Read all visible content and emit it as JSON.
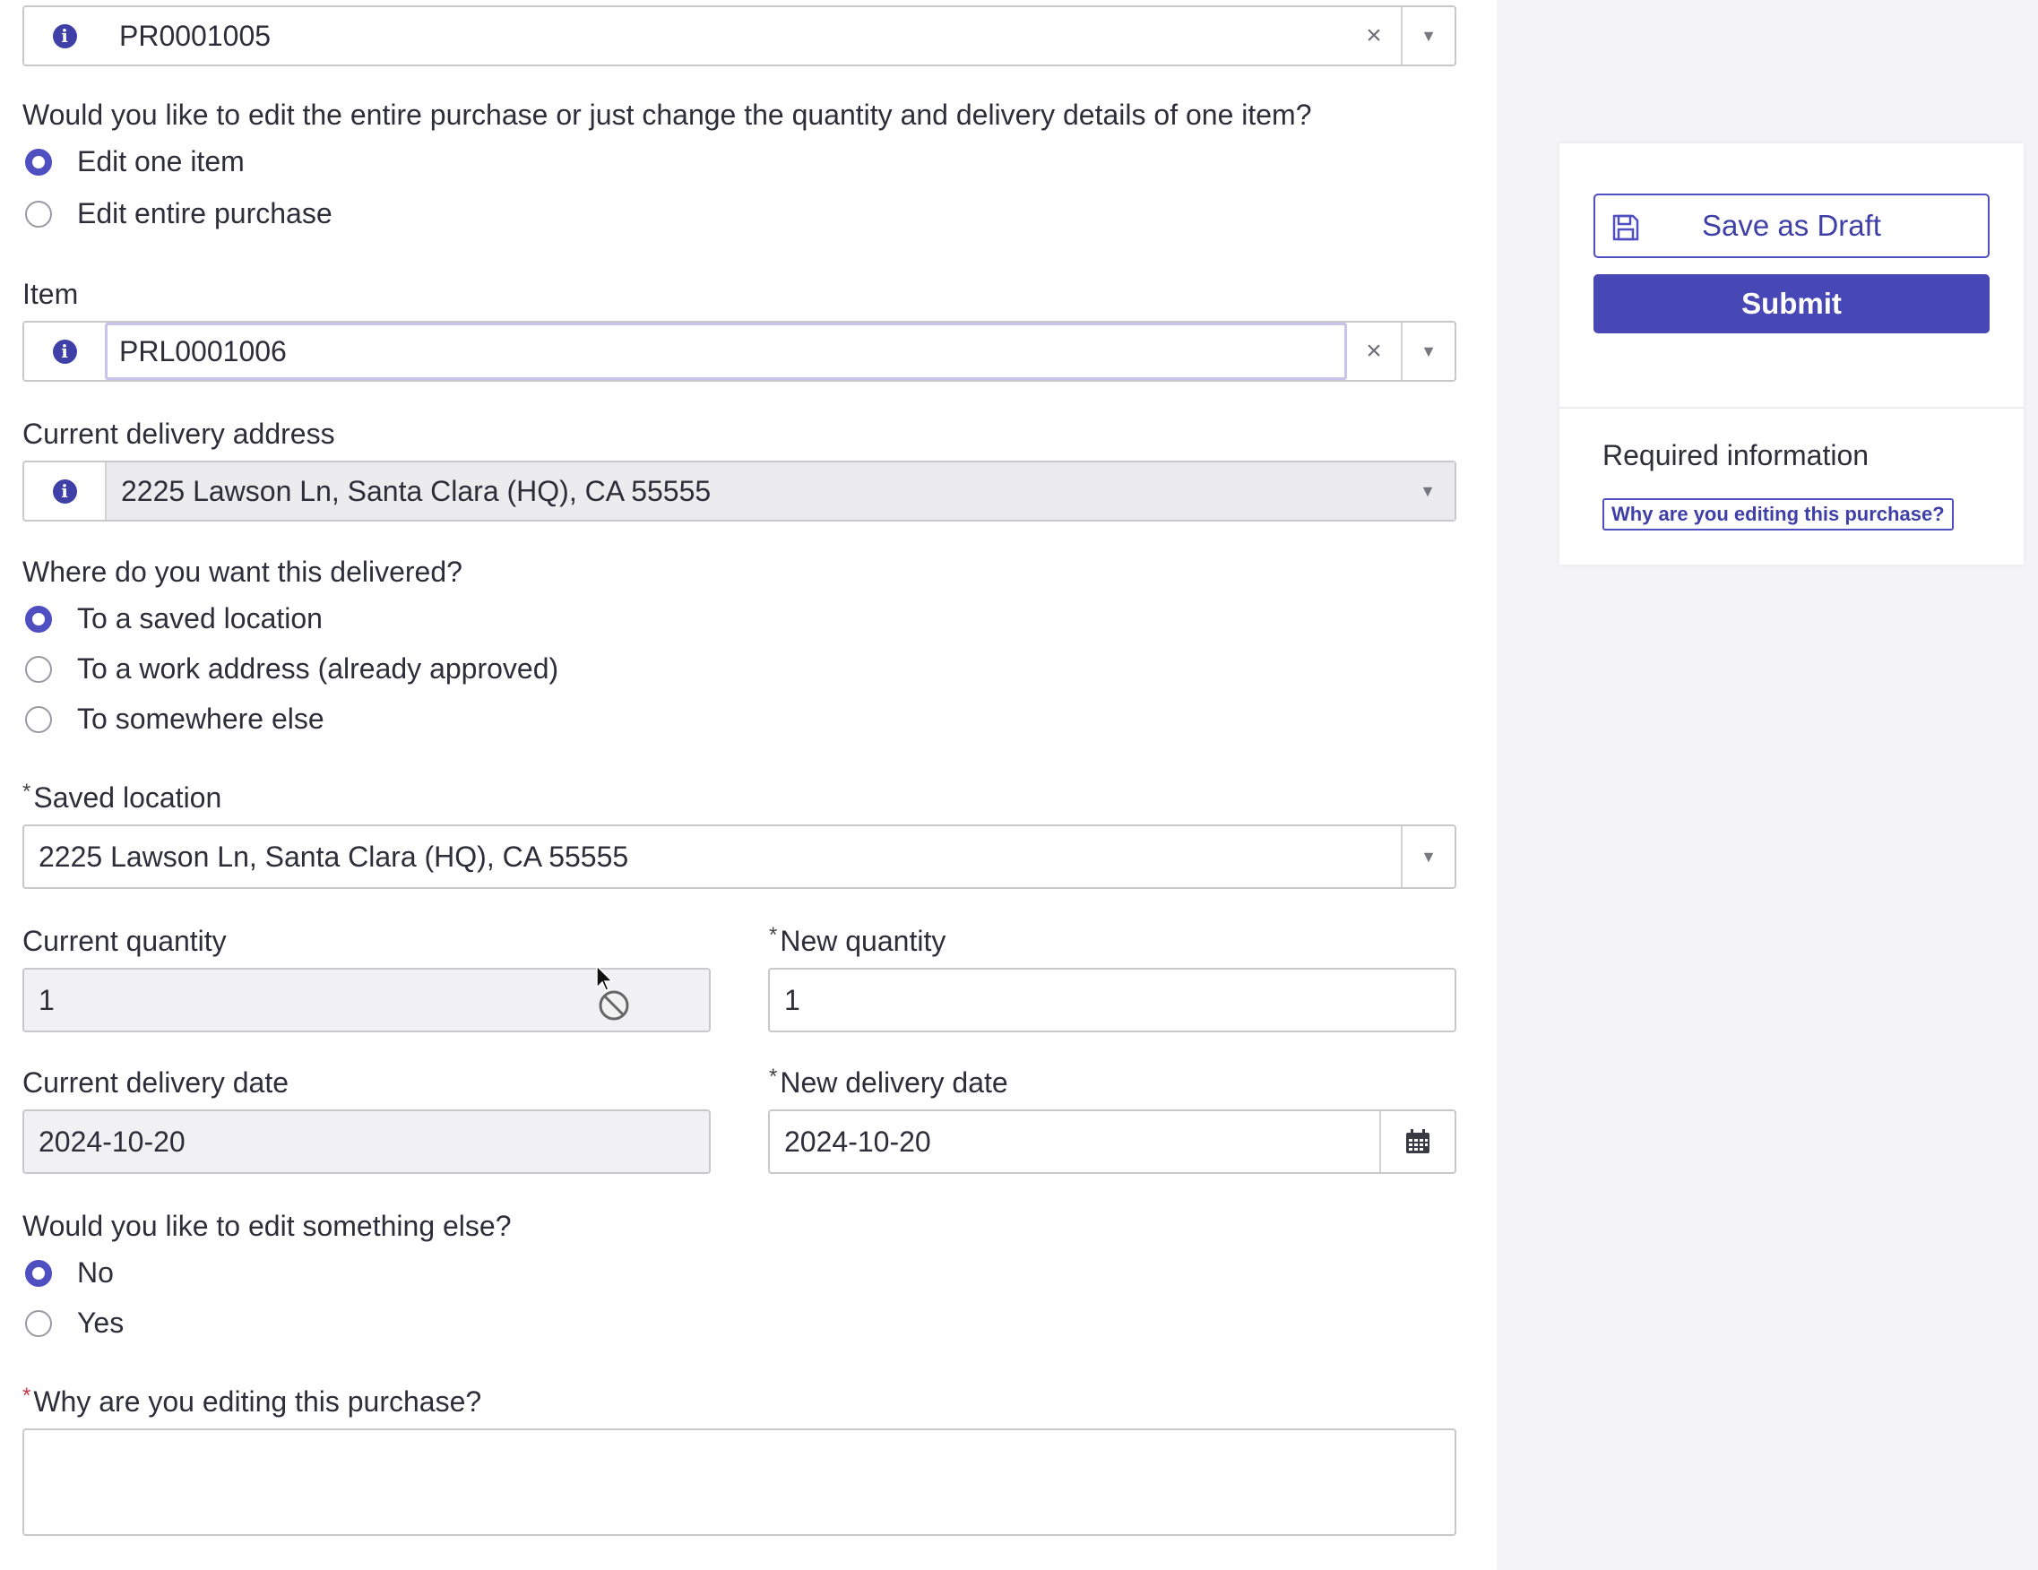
{
  "purchase_field": {
    "value": "PR0001005",
    "info_icon": "info-icon",
    "clear_icon": "clear-icon",
    "dropdown_icon": "chevron-down-icon"
  },
  "edit_scope": {
    "question": "Would you like to edit the entire purchase or just change the quantity and delivery details of one item?",
    "options": [
      {
        "label": "Edit one item",
        "selected": true
      },
      {
        "label": "Edit entire purchase",
        "selected": false
      }
    ]
  },
  "item_field": {
    "label": "Item",
    "value": "PRL0001006"
  },
  "current_address": {
    "label": "Current delivery address",
    "value": "2225 Lawson Ln, Santa Clara (HQ), CA 55555"
  },
  "delivery_choice": {
    "question": "Where do you want this delivered?",
    "options": [
      {
        "label": "To a saved location",
        "selected": true
      },
      {
        "label": "To a work address (already approved)",
        "selected": false
      },
      {
        "label": "To somewhere else",
        "selected": false
      }
    ]
  },
  "saved_location": {
    "required_mark": "*",
    "label": "Saved location",
    "value": "2225 Lawson Ln, Santa Clara (HQ), CA 55555"
  },
  "current_quantity": {
    "label": "Current quantity",
    "value": "1"
  },
  "new_quantity": {
    "required_mark": "*",
    "label": "New quantity",
    "value": "1"
  },
  "current_delivery_date": {
    "label": "Current delivery date",
    "value": "2024-10-20"
  },
  "new_delivery_date": {
    "required_mark": "*",
    "label": "New delivery date",
    "value": "2024-10-20",
    "icon": "calendar-icon"
  },
  "edit_else": {
    "question": "Would you like to edit something else?",
    "options": [
      {
        "label": "No",
        "selected": true
      },
      {
        "label": "Yes",
        "selected": false
      }
    ]
  },
  "reason": {
    "required_mark": "*",
    "label": "Why are you editing this purchase?",
    "value": ""
  },
  "sidebar": {
    "save_draft_label": "Save as Draft",
    "save_icon": "save-icon",
    "submit_label": "Submit",
    "required_title": "Required information",
    "required_links": [
      "Why are you editing this purchase?"
    ]
  },
  "colors": {
    "accent": "#4747b6",
    "required_red": "#d0364a",
    "border": "#c8c8cd",
    "sidebar_bg": "#f4f4f6"
  }
}
